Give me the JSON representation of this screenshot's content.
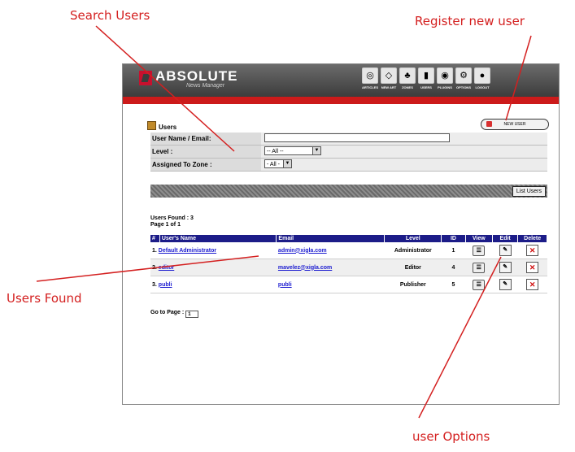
{
  "callouts": {
    "search_users": "Search Users",
    "register_new_user": "Register new user",
    "users_found": "Users Found",
    "user_options": "user Options"
  },
  "colors": {
    "callout": "#d42020",
    "header_red": "#cc1a1a",
    "table_header": "#1c1c88",
    "link": "#1a1ad0"
  },
  "app": {
    "logo": "ABSOLUTE",
    "logo_sub": "News Manager",
    "nav": [
      {
        "label": "ARTICLES",
        "icon": "articles-icon"
      },
      {
        "label": "NEW ART",
        "icon": "new-article-icon"
      },
      {
        "label": "ZONES",
        "icon": "zones-icon"
      },
      {
        "label": "USERS",
        "icon": "users-icon"
      },
      {
        "label": "PLUGINS",
        "icon": "plugins-icon"
      },
      {
        "label": "OPTIONS",
        "icon": "options-icon"
      },
      {
        "label": "LOGOUT",
        "icon": "logout-icon"
      }
    ]
  },
  "users_page": {
    "title": "Users",
    "new_user_label": "NEW USER",
    "search": {
      "name_email_label": "User Name / Email:",
      "name_email_value": "",
      "level_label": "Level :",
      "level_value": "-- All --",
      "zone_label": "Assigned To Zone :",
      "zone_value": "- All -",
      "list_button": "List Users"
    },
    "found_label": "Users Found : 3",
    "page_label": "Page 1 of 1",
    "columns": [
      "#",
      "User's Name",
      "Email",
      "Level",
      "ID",
      "View",
      "Edit",
      "Delete"
    ],
    "rows": [
      {
        "num": "1.",
        "name": "Default Administrator",
        "email": "admin@xigla.com",
        "level": "Administrator",
        "id": "1"
      },
      {
        "num": "2.",
        "name": "editor",
        "email": "mavelez@xigla.com",
        "level": "Editor",
        "id": "4"
      },
      {
        "num": "3.",
        "name": "publi",
        "email": "publi",
        "level": "Publisher",
        "id": "5"
      }
    ],
    "goto_label": "Go to Page :",
    "goto_value": "1"
  }
}
